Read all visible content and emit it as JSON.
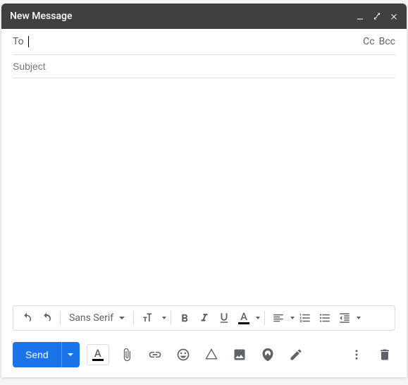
{
  "titlebar": {
    "title": "New Message"
  },
  "fields": {
    "to_label": "To",
    "to_value": "",
    "cc_label": "Cc",
    "bcc_label": "Bcc",
    "subject_placeholder": "Subject",
    "subject_value": ""
  },
  "toolbar": {
    "font_family": "Sans Serif"
  },
  "actions": {
    "send_label": "Send"
  }
}
